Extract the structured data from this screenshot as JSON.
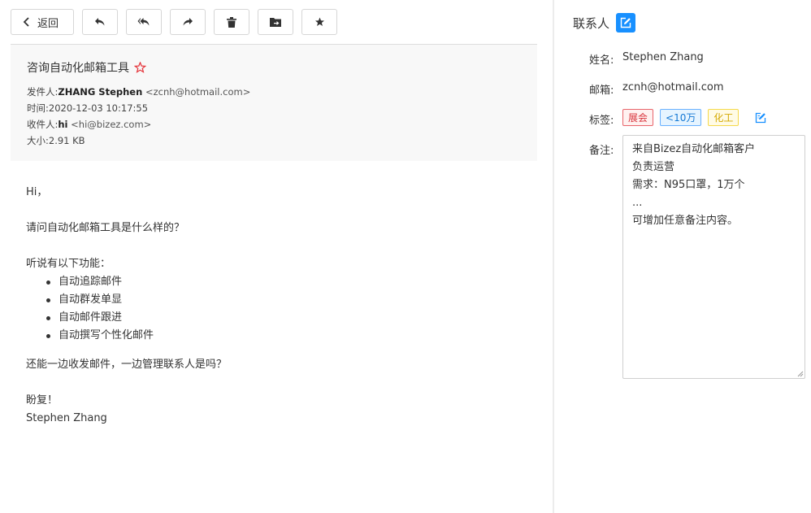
{
  "toolbar": {
    "back_label": "返回",
    "icons": [
      "back-arrow-icon",
      "reply-icon",
      "reply-all-icon",
      "forward-icon",
      "trash-icon",
      "move-to-folder-icon",
      "star-icon"
    ]
  },
  "email": {
    "subject": "咨询自动化邮箱工具",
    "from_label": "发件人:",
    "from_name": "ZHANG Stephen",
    "from_addr": "<zcnh@hotmail.com>",
    "time_label": "时间:",
    "time": "2020-12-03 10:17:55",
    "to_label": "收件人:",
    "to_name": "hi",
    "to_addr": "<hi@bizez.com>",
    "size_label": "大小:",
    "size": "2.91 KB",
    "body": {
      "greeting": "Hi，",
      "question": "请问自动化邮箱工具是什么样的？",
      "features_intro": "听说有以下功能：",
      "features": [
        "自动追踪邮件",
        "自动群发单显",
        "自动邮件跟进",
        "自动撰写个性化邮件"
      ],
      "question2": "还能一边收发邮件，一边管理联系人是吗？",
      "closing": "盼复！",
      "signature": "Stephen Zhang"
    }
  },
  "contact": {
    "title": "联系人",
    "name_label": "姓名:",
    "name": "Stephen Zhang",
    "email_label": "邮箱:",
    "email": "zcnh@hotmail.com",
    "tags_label": "标签:",
    "tags": [
      {
        "label": "展会",
        "color": "#d9363e"
      },
      {
        "label": "<10万",
        "color": "#1478d4"
      },
      {
        "label": "化工",
        "color": "#d4a900"
      }
    ],
    "notes_label": "备注:",
    "notes": [
      "来自Bizez自动化邮箱客户",
      "负责运营",
      "需求：N95口罩，1万个",
      "...",
      "可增加任意备注内容。"
    ]
  }
}
